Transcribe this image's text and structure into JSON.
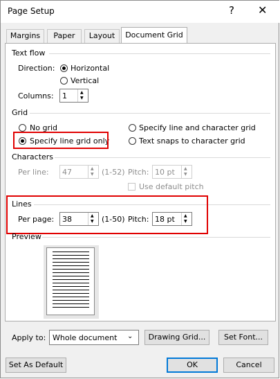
{
  "window": {
    "title": "Page Setup",
    "help": "?",
    "close": "✕"
  },
  "tabs": [
    "Margins",
    "Paper",
    "Layout",
    "Document Grid"
  ],
  "text_flow": {
    "label": "Text flow",
    "direction_label": "Direction:",
    "horizontal": "Horizontal",
    "vertical": "Vertical",
    "columns_label": "Columns:",
    "columns_value": "1"
  },
  "grid": {
    "label": "Grid",
    "no_grid": "No grid",
    "line_char_grid": "Specify line and character grid",
    "line_grid_only": "Specify line grid only",
    "text_snaps": "Text snaps to character grid"
  },
  "characters": {
    "label": "Characters",
    "per_line_label": "Per line:",
    "per_line_value": "47",
    "per_line_range": "(1-52)",
    "pitch_label": "Pitch:",
    "pitch_value": "10 pt",
    "default_pitch": "Use default pitch"
  },
  "lines": {
    "label": "Lines",
    "per_page_label": "Per page:",
    "per_page_value": "38",
    "per_page_range": "(1-50)",
    "pitch_label": "Pitch:",
    "pitch_value": "18 pt"
  },
  "preview": {
    "label": "Preview"
  },
  "apply": {
    "label": "Apply to:",
    "value": "Whole document"
  },
  "buttons": {
    "drawing_grid": "Drawing Grid...",
    "set_font": "Set Font...",
    "set_default": "Set As Default",
    "ok": "OK",
    "cancel": "Cancel"
  },
  "colors": {
    "highlight": "#e00000",
    "accent": "#0078d7"
  }
}
